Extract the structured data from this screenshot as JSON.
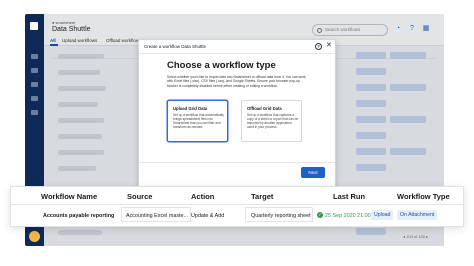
{
  "app": {
    "brand_small": "● smartsheet",
    "title": "Data Shuttle",
    "search_placeholder": "Search workflows",
    "tabs": [
      {
        "label": "All"
      },
      {
        "label": "Upload workflows"
      },
      {
        "label": "Offload workflows"
      }
    ],
    "header_icons": [
      "bell-icon",
      "help-icon",
      "apps-icon"
    ]
  },
  "modal": {
    "bar_title": "Create a workflow Data Shuttle",
    "help_glyph": "?",
    "close_glyph": "✕",
    "heading": "Choose a workflow type",
    "description": "Select whether you'd like to import data into Smartsheet or offload data from it. You can work with Excel files (.xlsx), CSV files (.csv), and Google Sheets. Ensure your browser pop-up blocker is completely disabled before either creating or editing a workflow.",
    "cards": [
      {
        "title": "Upload Grid Data",
        "desc": "Set up a workflow that automatically brings spreadsheet files into Smartsheet that you can filter and transform as needed."
      },
      {
        "title": "Offload Grid Data",
        "desc": "Set up a workflow that captures a copy of a sheet or report that can be imported by another application used in your process."
      }
    ],
    "next_label": "Next"
  },
  "table": {
    "headers": [
      "Workflow Name",
      "Source",
      "Action",
      "Target",
      "Last Run",
      "Workflow Type"
    ],
    "row": {
      "name": "Accounts payable reporting",
      "source": "Accounting Excel maste...",
      "action": "Update & Add",
      "target": "Quarterly reporting sheet",
      "last_run": "25 Sep 2020 21:00",
      "type_upload": "Upload",
      "type_trigger": "On Attachment"
    }
  },
  "pager": {
    "text": "◂ 104 of 100 ▸"
  },
  "colors": {
    "nav": "#0f2a57",
    "accent": "#1f5fc6",
    "success": "#2f9b4e"
  }
}
